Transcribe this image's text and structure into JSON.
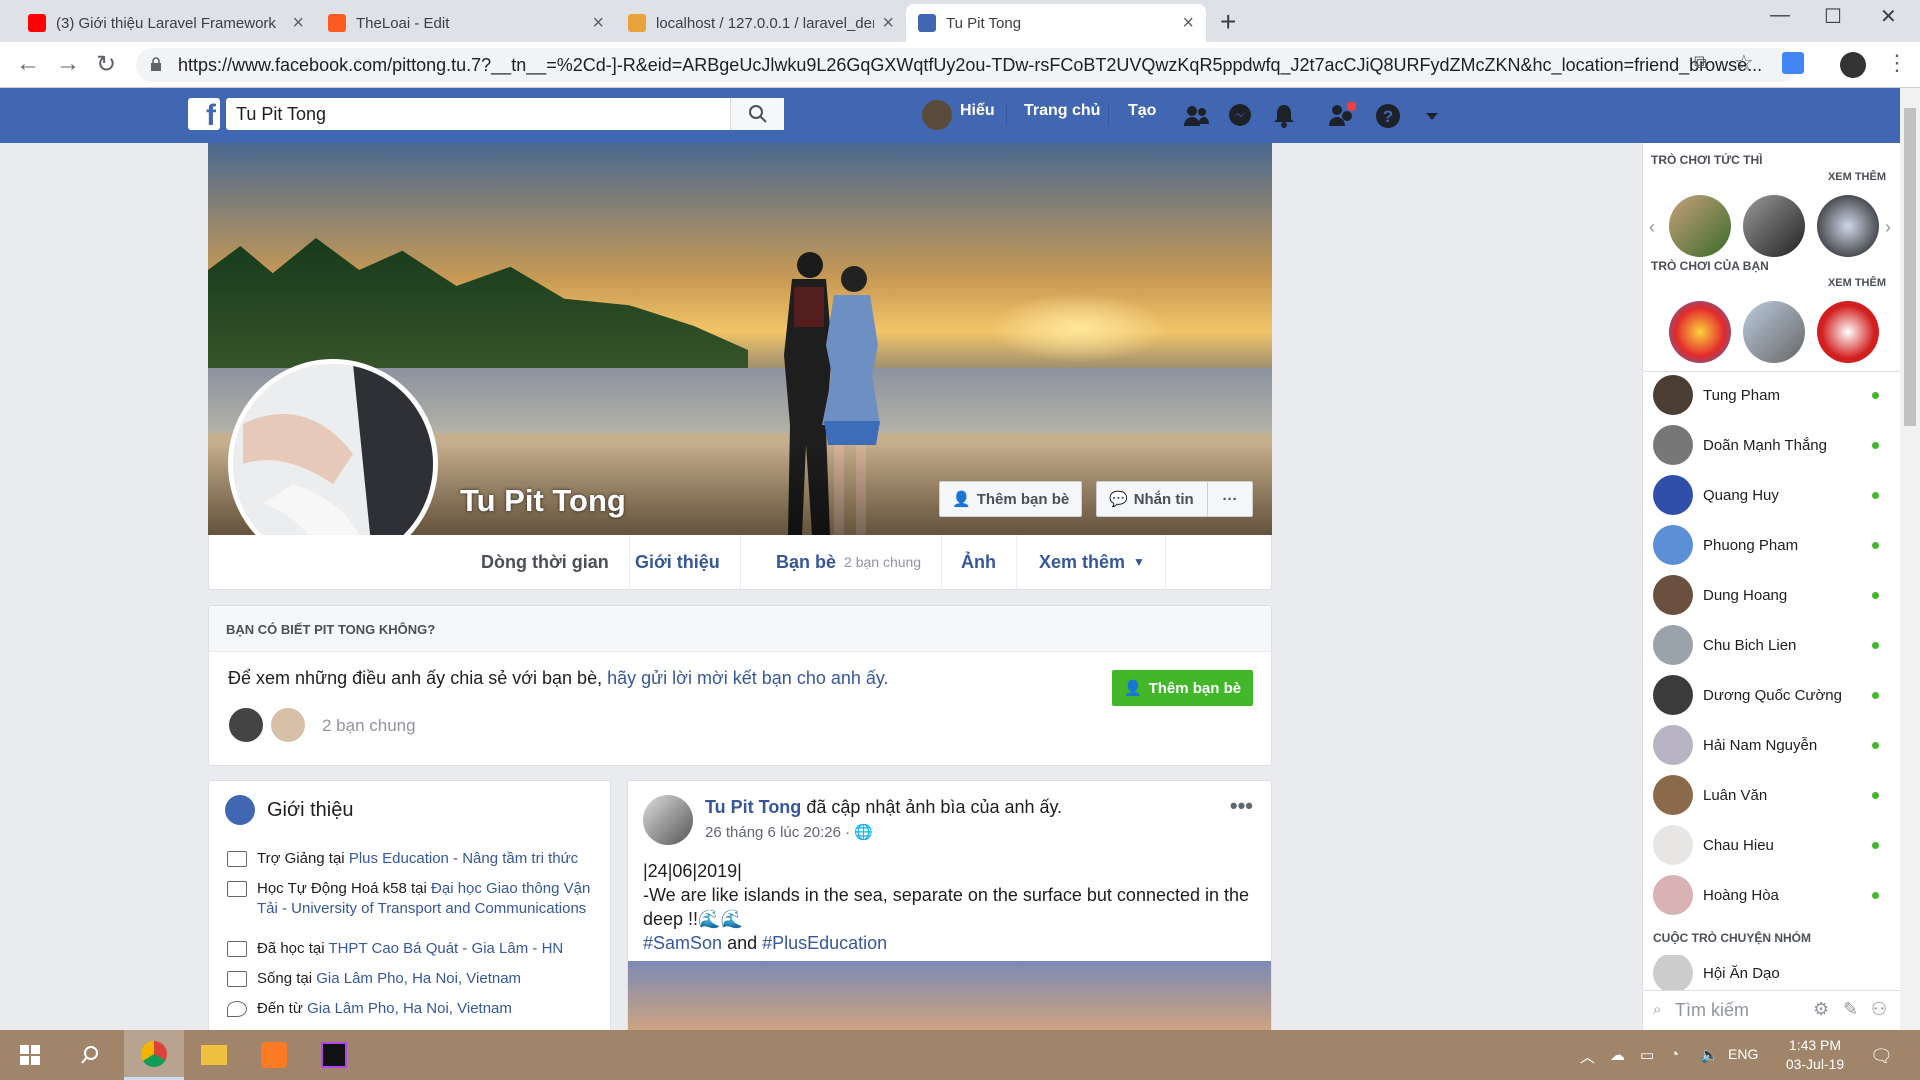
{
  "browser": {
    "tabs": [
      {
        "label": "(3) Giới thiệu Laravel Framework",
        "fav": "#ff0000"
      },
      {
        "label": "TheLoai - Edit",
        "fav": "#ff5a1f"
      },
      {
        "label": "localhost / 127.0.0.1 / laravel_den",
        "fav": "#e8a33a"
      },
      {
        "label": "Tu Pit Tong",
        "fav": "#4267b2"
      }
    ],
    "new_tab": "+",
    "url": "https://www.facebook.com/pittong.tu.7?__tn__=%2Cd-]-R&eid=ARBgeUcJlwku9L26GqGXWqtfUy2ou-TDw-rsFCoBT2UVQwzKqR5ppdwfq_J2t7acCJiQ8URFydZMcZKN&hc_location=friend_browse..."
  },
  "fb": {
    "search_value": "Tu Pit Tong",
    "user": "Hiếu",
    "home": "Trang chủ",
    "create": "Tạo"
  },
  "profile": {
    "name": "Tu Pit Tong",
    "add_friend": "Thêm bạn bè",
    "message": "Nhắn tin",
    "more": "···",
    "tabs": {
      "timeline": "Dòng thời gian",
      "about": "Giới thiệu",
      "friends": "Bạn bè",
      "friends_sub": "2 bạn chung",
      "photos": "Ảnh",
      "more": "Xem thêm"
    }
  },
  "know": {
    "title": "BẠN CÓ BIẾT PIT TONG KHÔNG?",
    "text": "Để xem những điều anh ấy chia sẻ với bạn bè, ",
    "link": "hãy gửi lời mời kết bạn cho anh ấy.",
    "button": "Thêm bạn bè",
    "mutual": "2 bạn chung"
  },
  "intro": {
    "title": "Giới thiệu",
    "rows": [
      {
        "pre": "Trợ Giảng tại ",
        "link": "Plus Education - Nâng tầm tri thức"
      },
      {
        "pre": "Học Tự Động Hoá k58 tại ",
        "link": "Đại học Giao thông Vận Tải - University of Transport and Communications"
      },
      {
        "pre": "Đã học tại ",
        "link": "THPT Cao Bá Quát - Gia Lâm - HN"
      },
      {
        "pre": "Sống tại ",
        "link": "Gia Lâm Pho, Ha Noi, Vietnam"
      },
      {
        "pre": "Đến từ ",
        "link": "Gia Lâm Pho, Ha Noi, Vietnam"
      }
    ]
  },
  "post": {
    "author": "Tu Pit Tong",
    "action": " đã cập nhật ảnh bìa của anh ấy.",
    "time": "26 tháng 6 lúc 20:26 ·",
    "line1": "|24|06|2019|",
    "line2": "-We are like islands in the sea, separate on the surface but connected in the deep !!🌊🌊",
    "tag1": "#SamSon",
    "and": " and ",
    "tag2": "#PlusEducation",
    "dots": "•••"
  },
  "chat": {
    "instant_games": "TRÒ CHƠI TỨC THÌ",
    "your_games": "TRÒ CHƠI CỦA BẠN",
    "see_more": "XEM THÊM",
    "group_chats": "CUỘC TRÒ CHUYỆN NHÓM",
    "group_first": "Hội Ăn Dạo",
    "search_placeholder": "Tìm kiếm",
    "friends": [
      "Tung Pham",
      "Doãn Mạnh Thắng",
      "Quang Huy",
      "Phuong Pham",
      "Dung Hoang",
      "Chu Bich Lien",
      "Dương Quốc Cường",
      "Hải Nam Nguyễn",
      "Luân Văn",
      "Chau Hieu",
      "Hoàng Hòa"
    ]
  },
  "taskbar": {
    "lang": "ENG",
    "time": "1:43 PM",
    "date": "03-Jul-19"
  }
}
